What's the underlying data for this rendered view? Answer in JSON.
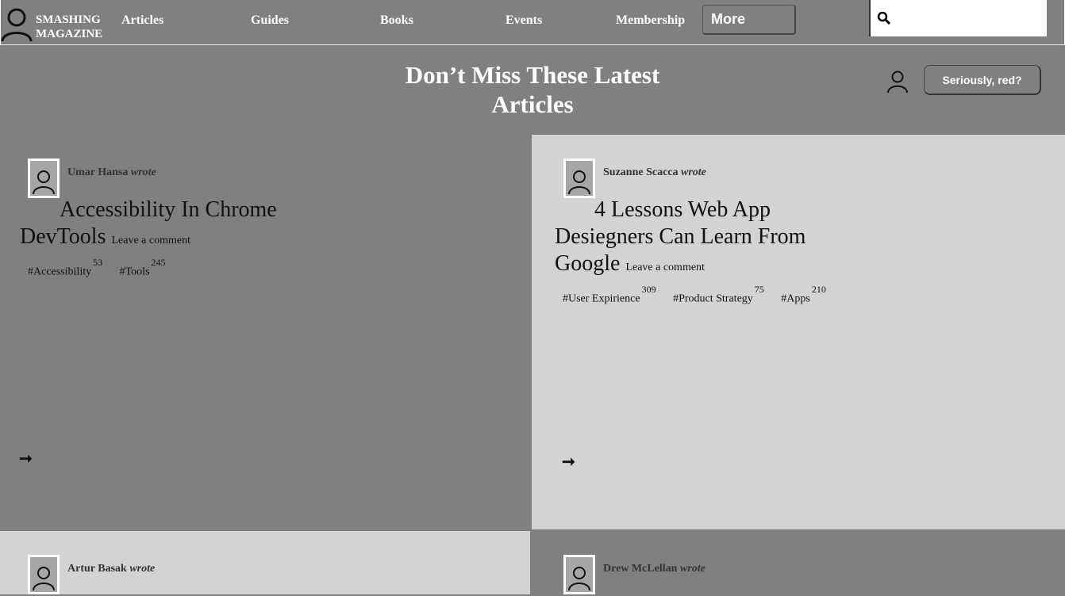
{
  "nav": {
    "logo_line1": "SMASHING",
    "logo_line2": "MAGAZINE",
    "links": [
      "Articles",
      "Guides",
      "Books",
      "Events",
      "Membership"
    ],
    "more_label": "More",
    "search_placeholder": ""
  },
  "hero": {
    "title_line1": "Don’t Miss These Latest",
    "title_line2": "Articles",
    "button_label": "Seriously, red?"
  },
  "articles": [
    {
      "author": "Umar Hansa",
      "wrote": "wrote",
      "title": "Accessibility In Chrome DevTools",
      "comment": "Leave a comment",
      "tags": [
        {
          "name": "#Accessibility",
          "count": "53"
        },
        {
          "name": "#Tools",
          "count": "245"
        }
      ],
      "arrow": "➞"
    },
    {
      "author": "Suzanne Scacca",
      "wrote": "wrote",
      "title": "4 Lessons Web App Desiegners Can Learn From Google",
      "comment": "Leave a comment",
      "tags": [
        {
          "name": "#User Expirience",
          "count": "309"
        },
        {
          "name": "#Product Strategy",
          "count": "75"
        },
        {
          "name": "#Apps",
          "count": "210"
        }
      ],
      "arrow": "➞"
    },
    {
      "author": "Artur Basak",
      "wrote": "wrote"
    },
    {
      "author": "Drew McLellan",
      "wrote": "wrote"
    }
  ],
  "colors": {
    "dark_card": "#808080",
    "light_card": "#d3d3d3",
    "text_light": "#ffffff"
  }
}
